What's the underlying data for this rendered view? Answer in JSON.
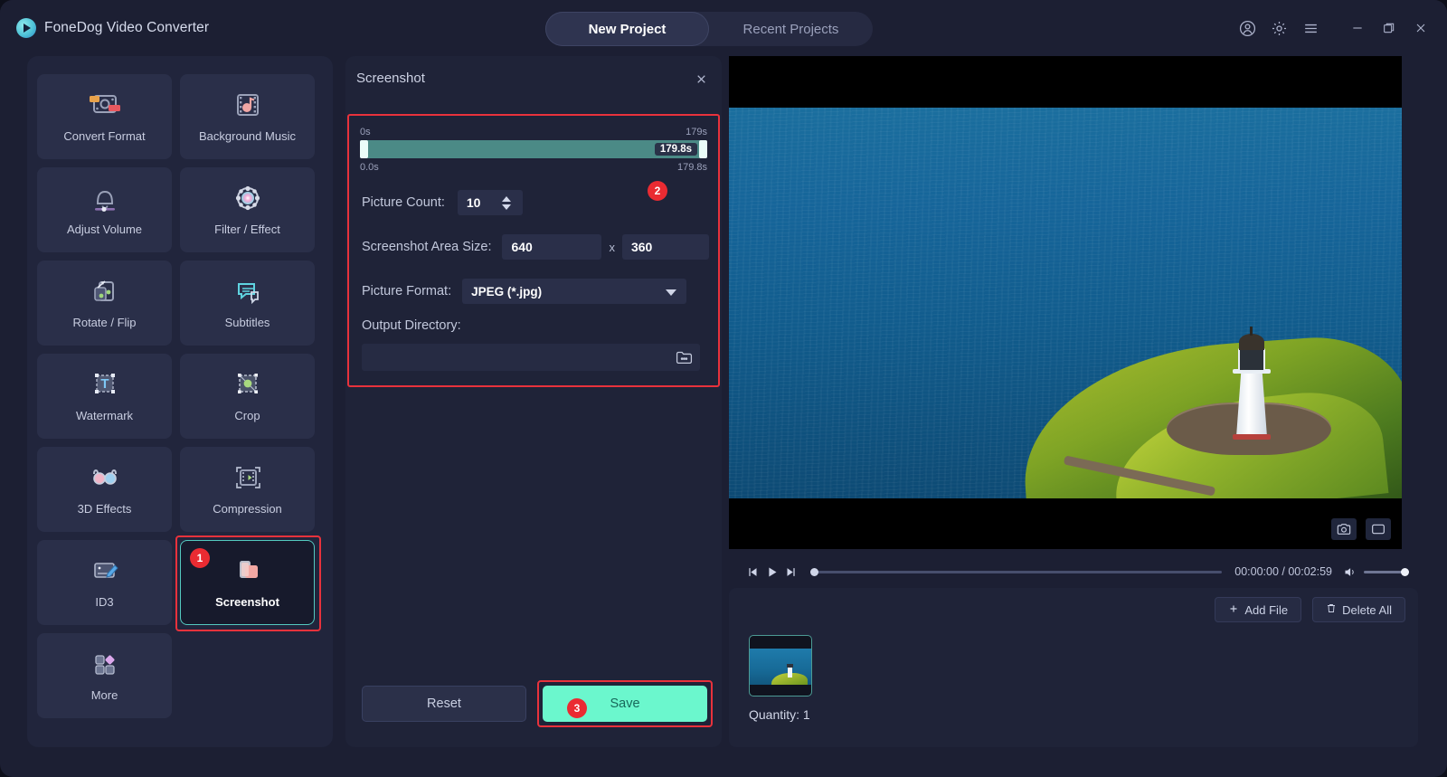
{
  "app": {
    "brand": "FoneDog Video Converter",
    "logo_icon": "play-circle-logo"
  },
  "header": {
    "tabs": [
      {
        "label": "New Project",
        "active": true
      },
      {
        "label": "Recent Projects",
        "active": false
      }
    ],
    "window_icons": [
      "account-icon",
      "gear-icon",
      "menu-icon",
      "minimize-icon",
      "maximize-icon",
      "close-icon"
    ]
  },
  "sidebar": {
    "tools": [
      {
        "label": "Convert Format",
        "icon": "convert-format-icon",
        "selected": false
      },
      {
        "label": "Background Music",
        "icon": "background-music-icon",
        "selected": false
      },
      {
        "label": "Adjust Volume",
        "icon": "adjust-volume-icon",
        "selected": false
      },
      {
        "label": "Filter / Effect",
        "icon": "filter-effect-icon",
        "selected": false
      },
      {
        "label": "Rotate / Flip",
        "icon": "rotate-flip-icon",
        "selected": false
      },
      {
        "label": "Subtitles",
        "icon": "subtitles-icon",
        "selected": false
      },
      {
        "label": "Watermark",
        "icon": "watermark-icon",
        "selected": false
      },
      {
        "label": "Crop",
        "icon": "crop-icon",
        "selected": false
      },
      {
        "label": "3D Effects",
        "icon": "3d-effects-icon",
        "selected": false
      },
      {
        "label": "Compression",
        "icon": "compression-icon",
        "selected": false
      },
      {
        "label": "ID3",
        "icon": "id3-icon",
        "selected": false
      },
      {
        "label": "Screenshot",
        "icon": "screenshot-icon",
        "selected": true
      },
      {
        "label": "More",
        "icon": "more-icon",
        "selected": false
      }
    ]
  },
  "panel": {
    "title": "Screenshot",
    "close_icon": "close-icon",
    "slider": {
      "tick_start": "0s",
      "tick_end": "179s",
      "foot_start": "0.0s",
      "foot_end": "179.8s",
      "bubble": "179.8s"
    },
    "picture_count": {
      "label": "Picture Count:",
      "value": "10"
    },
    "area_size": {
      "label": "Screenshot Area Size:",
      "width": "640",
      "separator": "x",
      "height": "360"
    },
    "picture_format": {
      "label": "Picture Format:",
      "value": "JPEG (*.jpg)",
      "caret_icon": "chevron-down-icon"
    },
    "output_directory": {
      "label": "Output Directory:",
      "value": "",
      "placeholder": "",
      "browse_icon": "folder-icon"
    },
    "buttons": {
      "reset": "Reset",
      "save": "Save"
    },
    "badges": {
      "step1": "1",
      "step2": "2",
      "step3": "3"
    },
    "highlight_color": "#e8323c",
    "save_color": "#6bf7cd"
  },
  "player": {
    "prev_icon": "skip-previous-icon",
    "play_icon": "play-icon",
    "next_icon": "skip-next-icon",
    "time": "00:00:00 / 00:02:59",
    "volume_icon": "volume-icon",
    "snapshot_icon": "camera-icon",
    "fullscreen_icon": "screen-icon"
  },
  "filelist": {
    "add_file": "Add File",
    "add_file_icon": "plus-icon",
    "delete_all": "Delete All",
    "delete_all_icon": "trash-icon",
    "quantity": "Quantity: 1"
  }
}
